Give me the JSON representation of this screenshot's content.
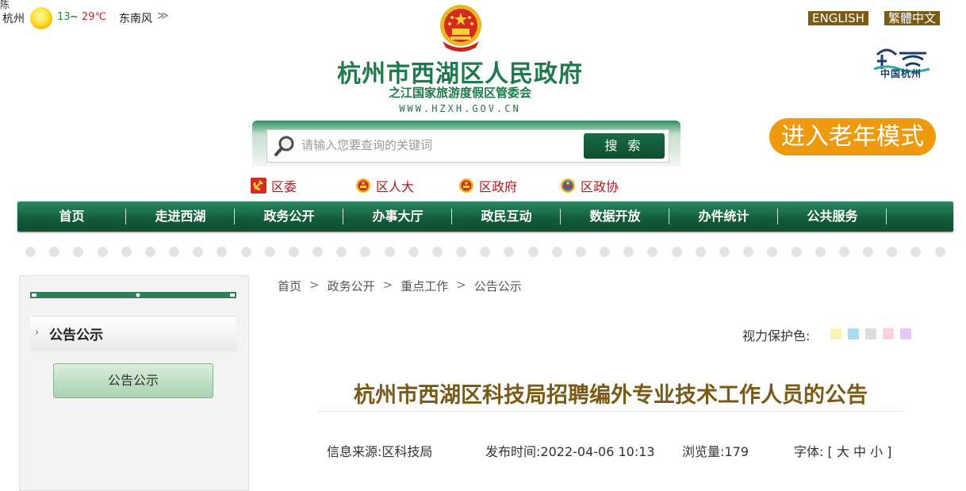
{
  "top": {
    "corner_text": "陈",
    "weather": {
      "city": "杭州",
      "temp_low": "13",
      "temp_sep": "~",
      "temp_high": "29℃",
      "wind": "东南风",
      "more": "≫"
    },
    "languages": [
      "ENGLISH",
      "繁體中文"
    ]
  },
  "header": {
    "title": "杭州市西湖区人民政府",
    "subtitle": "之江国家旅游度假区管委会",
    "url": "WWW.HZXH.GOV.CN",
    "logo_text": "中国杭州",
    "colors": {
      "primary_green": "#1f7a4b",
      "gold": "#7a5a14",
      "elder_orange": "#ef9a0c"
    }
  },
  "search": {
    "placeholder": "请输入您要查询的关键词",
    "button": "搜 索"
  },
  "elder_mode": {
    "label": "进入老年模式"
  },
  "quick_links": [
    {
      "label": "区委",
      "icon": "party-emblem-icon"
    },
    {
      "label": "区人大",
      "icon": "national-emblem-icon"
    },
    {
      "label": "区政府",
      "icon": "national-emblem-icon"
    },
    {
      "label": "区政协",
      "icon": "cppcc-emblem-icon"
    }
  ],
  "nav": [
    "首页",
    "走进西湖",
    "政务公开",
    "办事大厅",
    "政民互动",
    "数据开放",
    "办件统计",
    "公共服务"
  ],
  "sidebar": {
    "heading": "公告公示",
    "items": [
      "公告公示"
    ]
  },
  "breadcrumb": [
    "首页",
    "政务公开",
    "重点工作",
    "公告公示"
  ],
  "eye_protect": {
    "label": "视力保护色:",
    "colors": [
      "#fbf3b6",
      "#a9dcf4",
      "#dcdcdc",
      "#f9d1e0",
      "#e5c8f3"
    ]
  },
  "article": {
    "title": "杭州市西湖区科技局招聘编外专业技术工作人员的公告",
    "source_label": "信息来源:",
    "source": "区科技局",
    "date_label": "发布时间:",
    "date": "2022-04-06 10:13",
    "views_label": "浏览量:",
    "views": "179",
    "font_label": "字体:",
    "font_options": [
      "大",
      "中",
      "小"
    ]
  }
}
